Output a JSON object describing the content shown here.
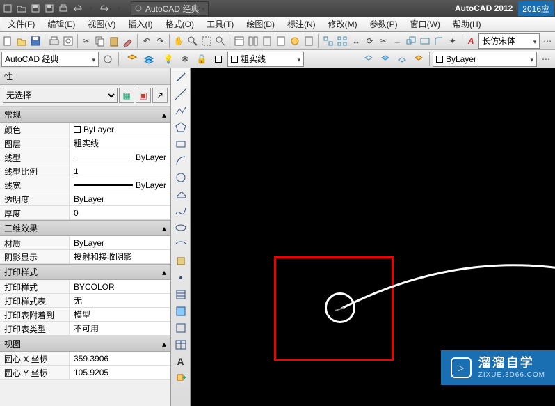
{
  "title": {
    "app": "AutoCAD 2012",
    "extra": "2016应"
  },
  "qat_workspace": "AutoCAD 经典",
  "menus": [
    "文件(F)",
    "编辑(E)",
    "视图(V)",
    "插入(I)",
    "格式(O)",
    "工具(T)",
    "绘图(D)",
    "标注(N)",
    "修改(M)",
    "参数(P)",
    "窗口(W)",
    "帮助(H)"
  ],
  "workspace_combo": "AutoCAD 经典",
  "layer_combo": "粗实线",
  "textstyle_combo": "长仿宋体",
  "bylayer_combo": "ByLayer",
  "props": {
    "panel_title": "性",
    "selection": "无选择",
    "sections": {
      "general": {
        "title": "常规",
        "rows": [
          {
            "name": "颜色",
            "value": "ByLayer",
            "swatch": true
          },
          {
            "name": "图层",
            "value": "粗实线"
          },
          {
            "name": "线型",
            "value": "ByLayer",
            "line": "thin"
          },
          {
            "name": "线型比例",
            "value": "1"
          },
          {
            "name": "线宽",
            "value": "ByLayer",
            "line": "thick"
          },
          {
            "name": "透明度",
            "value": "ByLayer"
          },
          {
            "name": "厚度",
            "value": "0"
          }
        ]
      },
      "threed": {
        "title": "三维效果",
        "rows": [
          {
            "name": "材质",
            "value": "ByLayer"
          },
          {
            "name": "阴影显示",
            "value": "投射和接收阴影"
          }
        ]
      },
      "plot": {
        "title": "打印样式",
        "rows": [
          {
            "name": "打印样式",
            "value": "BYCOLOR"
          },
          {
            "name": "打印样式表",
            "value": "无"
          },
          {
            "name": "打印表附着到",
            "value": "模型"
          },
          {
            "name": "打印表类型",
            "value": "不可用"
          }
        ]
      },
      "view": {
        "title": "视图",
        "rows": [
          {
            "name": "圆心 X 坐标",
            "value": "359.3906"
          },
          {
            "name": "圆心 Y 坐标",
            "value": "105.9205"
          }
        ]
      }
    }
  },
  "watermark": {
    "big": "溜溜自学",
    "small": "ZIXUE.3D66.COM",
    "play": "▷"
  }
}
